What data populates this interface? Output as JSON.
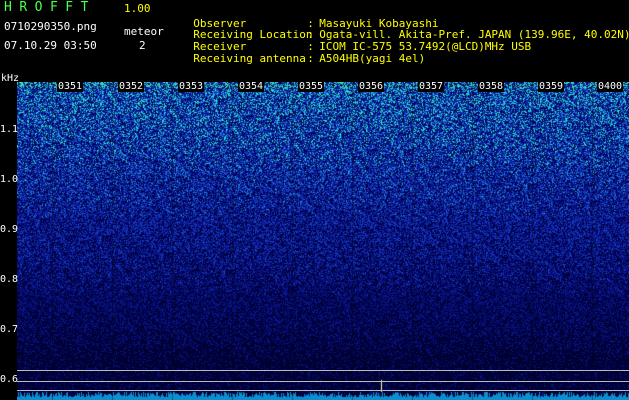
{
  "app": {
    "title": "HROFFT",
    "version": "1.00"
  },
  "file": {
    "name": "0710290350.png",
    "datetime": "07.10.29 03:50"
  },
  "meteor": {
    "label": "meteor",
    "count": "2"
  },
  "meta": [
    {
      "label": "Observer",
      "value": "Masayuki Kobayashi"
    },
    {
      "label": "Receiving Location",
      "value": "Ogata-vill. Akita-Pref. JAPAN (139.96E, 40.02N)"
    },
    {
      "label": "Receiver",
      "value": "ICOM IC-575 53.7492(@LCD)MHz USB"
    },
    {
      "label": "Receiving antenna",
      "value": "A504HB(yagi 4el)"
    }
  ],
  "axis": {
    "unit": "kHz",
    "freq_labels": [
      "1.1",
      "1.0",
      "0.9",
      "0.8",
      "0.7",
      "0.6"
    ],
    "time_labels": [
      "0351",
      "0352",
      "0353",
      "0354",
      "0355",
      "0356",
      "0357",
      "0358",
      "0359",
      "0400"
    ]
  },
  "colors": {
    "title": "#4cff4c",
    "meta": "#ffff00",
    "noise_low": "#00005a",
    "noise_high": "#00ffcc"
  }
}
